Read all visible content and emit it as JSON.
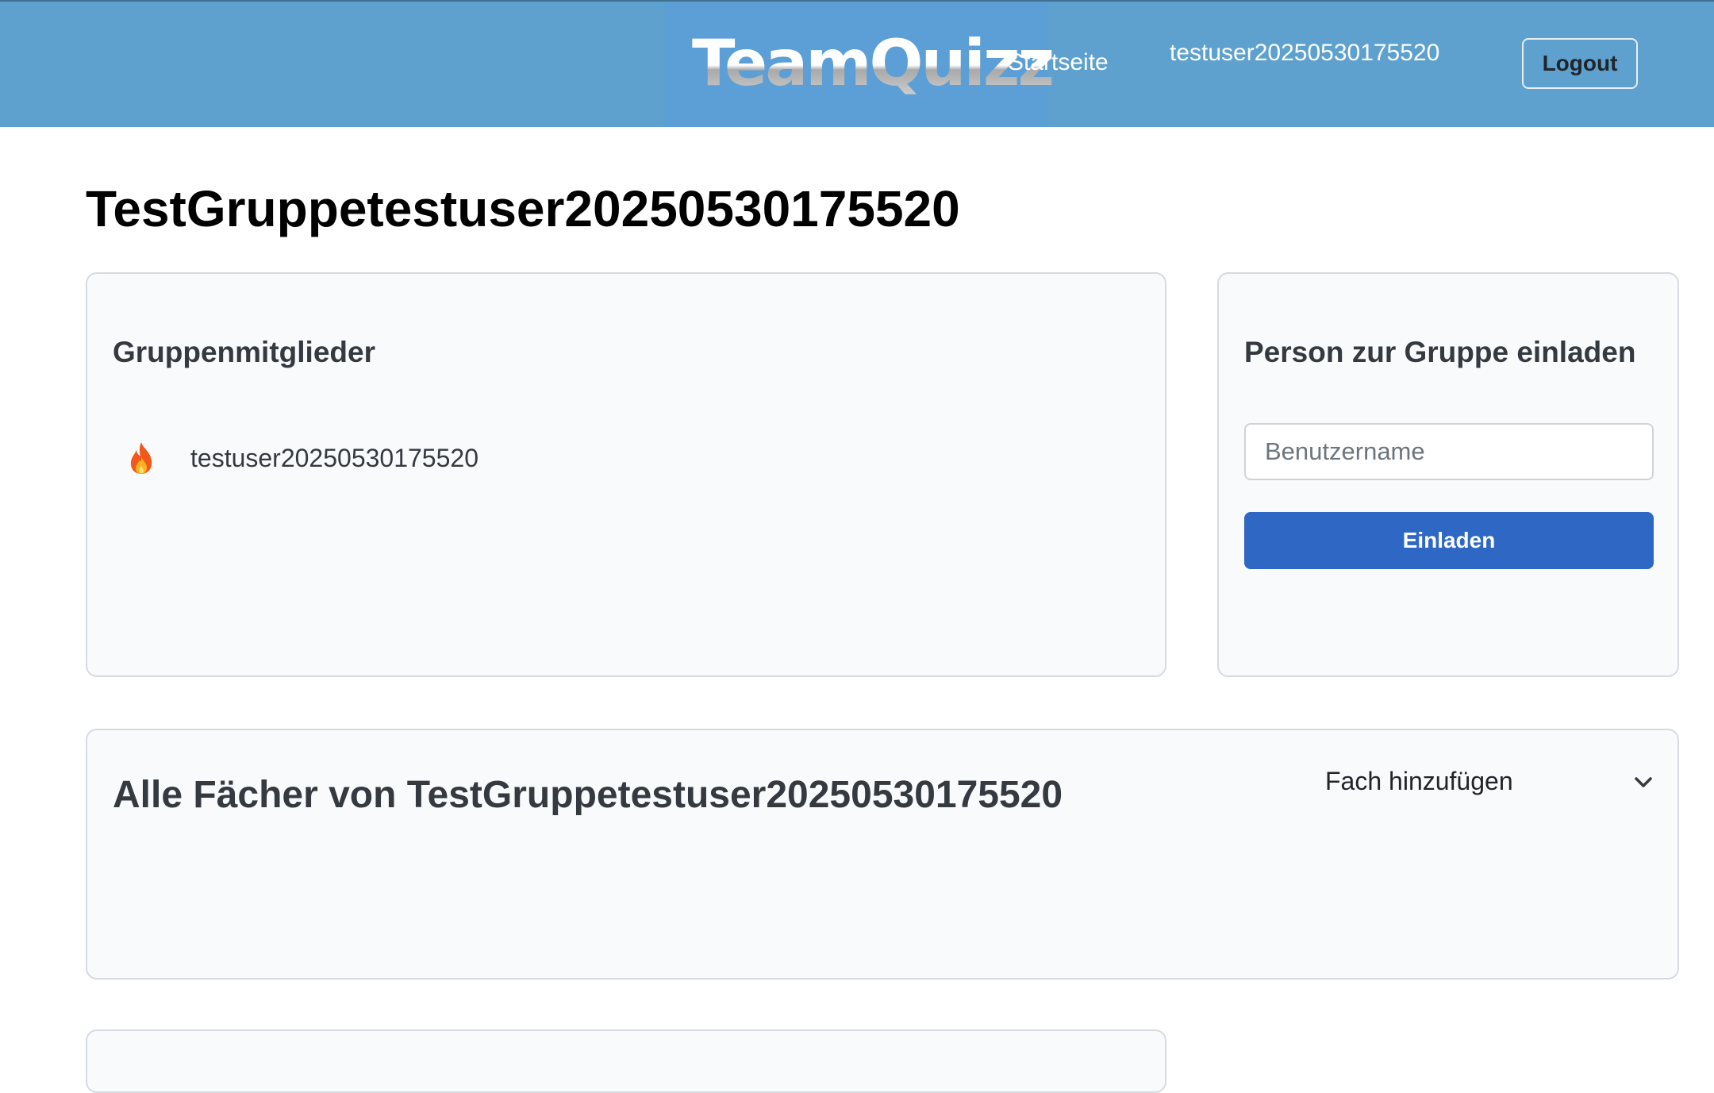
{
  "header": {
    "logo": "TeamQuizz",
    "nav_home": "Startseite",
    "username": "testuser20250530175520",
    "logout_label": "Logout"
  },
  "page": {
    "title": "TestGruppetestuser20250530175520"
  },
  "members": {
    "title": "Gruppenmitglieder",
    "items": [
      {
        "icon": "fire-icon",
        "name": "testuser20250530175520"
      }
    ]
  },
  "invite": {
    "title": "Person zur Gruppe einladen",
    "input_placeholder": "Benutzername",
    "input_value": "",
    "button_label": "Einladen"
  },
  "subjects": {
    "title": "Alle Fächer von TestGruppetestuser20250530175520",
    "add_label": "Fach hinzufügen",
    "add_icon": "chevron-down-icon"
  },
  "colors": {
    "navbar": "#5ea1cf",
    "primary_button": "#2f67c4",
    "card_background": "#f9fafc"
  }
}
